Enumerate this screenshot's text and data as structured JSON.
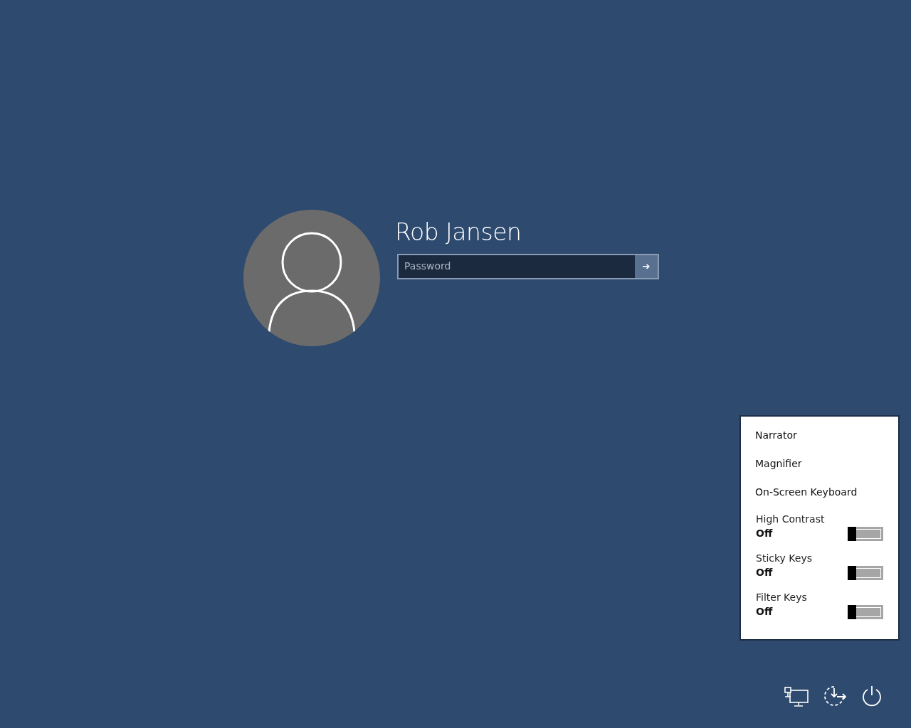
{
  "user": {
    "name": "Rob Jansen"
  },
  "password": {
    "placeholder": "Password",
    "submit": "➔"
  },
  "ease_menu": {
    "items": [
      {
        "kind": "link",
        "label": "Narrator"
      },
      {
        "kind": "link",
        "label": "Magnifier"
      },
      {
        "kind": "link",
        "label": "On-Screen Keyboard"
      },
      {
        "kind": "toggle",
        "label": "High Contrast",
        "state_text": "Off",
        "on": false
      },
      {
        "kind": "toggle",
        "label": "Sticky Keys",
        "state_text": "Off",
        "on": false
      },
      {
        "kind": "toggle",
        "label": "Filter Keys",
        "state_text": "Off",
        "on": false
      }
    ]
  }
}
